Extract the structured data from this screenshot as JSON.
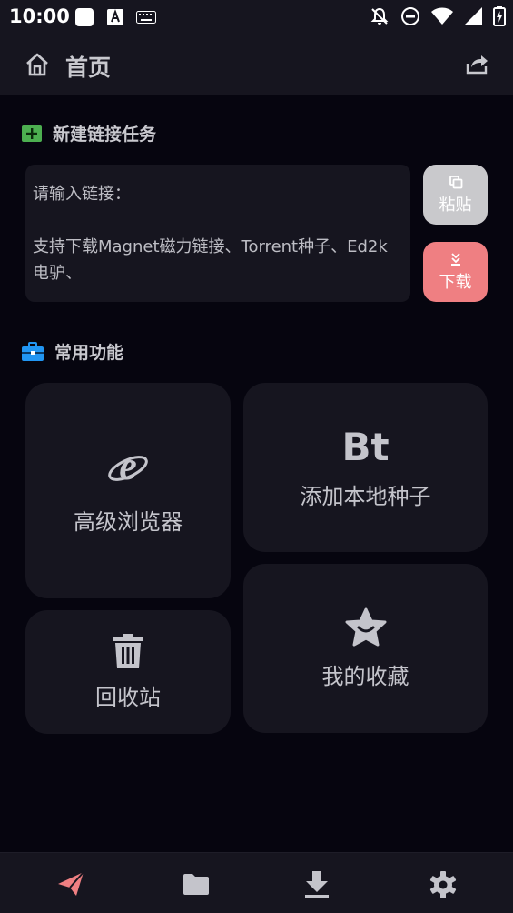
{
  "status_bar": {
    "time": "10:00",
    "icons": [
      "square-notification-icon",
      "font-a-icon",
      "keyboard-icon",
      "notification-off-icon",
      "do-not-disturb-icon",
      "wifi-icon",
      "signal-icon",
      "battery-charging-icon"
    ]
  },
  "app_bar": {
    "title": "首页",
    "icons": [
      "home-icon",
      "share-icon"
    ]
  },
  "new_task": {
    "title": "新建链接任务",
    "icon": "add-box-icon",
    "placeholder_line1": "请输入链接：",
    "placeholder_line2": "支持下载Magnet磁力链接、Torrent种子、Ed2k电驴、",
    "paste_label": "粘贴",
    "download_label": "下载"
  },
  "common": {
    "title": "常用功能",
    "icon": "toolbox-icon",
    "browser_label": "高级浏览器",
    "bt_glyph": "Bt",
    "bt_label": "添加本地种子",
    "recycle_label": "回收站",
    "favorites_label": "我的收藏"
  },
  "bottom_nav": {
    "items": [
      "send-icon",
      "folder-icon",
      "download-icon",
      "settings-icon"
    ],
    "active_color": "#ef7f82"
  },
  "colors": {
    "background": "#06050f",
    "surface": "#16151f",
    "accent_pink": "#ef7f82",
    "accent_green": "#4caf50",
    "accent_blue": "#2196f3"
  }
}
